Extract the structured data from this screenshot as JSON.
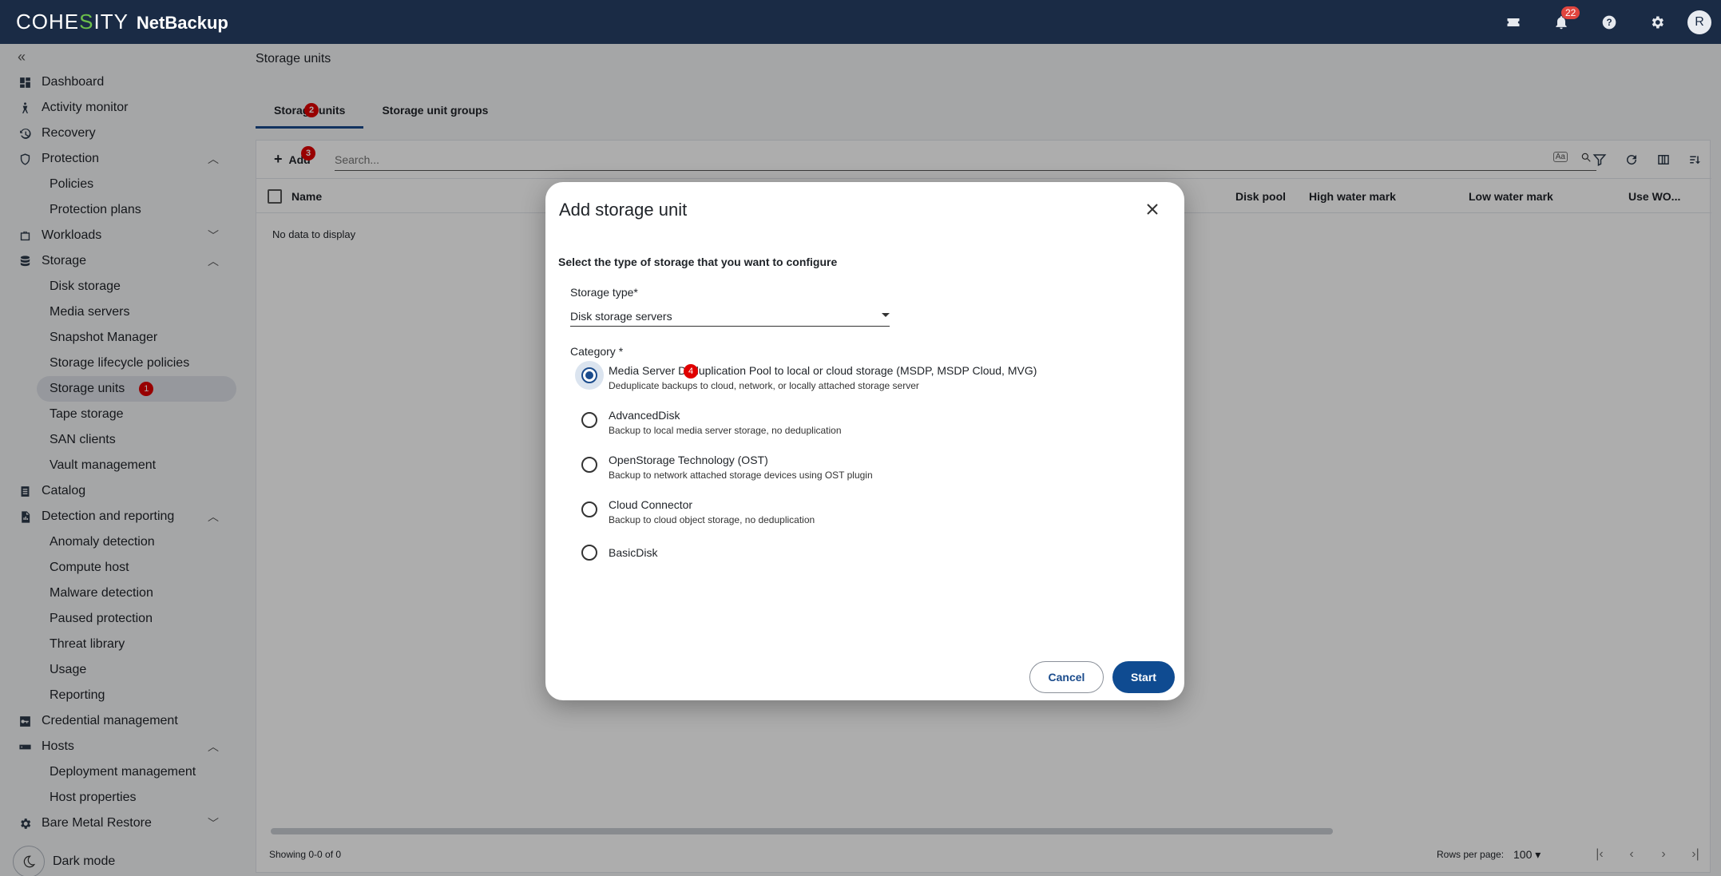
{
  "topbar": {
    "brand_left": "COHE",
    "brand_s": "S",
    "brand_right": "ITY",
    "product": "NetBackup",
    "notifications": "22",
    "avatar": "R"
  },
  "sidebar": {
    "dashboard": "Dashboard",
    "activity": "Activity monitor",
    "recovery": "Recovery",
    "protection": "Protection",
    "policies": "Policies",
    "protection_plans": "Protection plans",
    "workloads": "Workloads",
    "storage": "Storage",
    "disk_storage": "Disk storage",
    "media_servers": "Media servers",
    "snapshot_manager": "Snapshot Manager",
    "slp": "Storage lifecycle policies",
    "storage_units": "Storage units",
    "storage_units_badge": "1",
    "tape_storage": "Tape storage",
    "san_clients": "SAN clients",
    "vault": "Vault management",
    "catalog": "Catalog",
    "detection": "Detection and reporting",
    "anomaly": "Anomaly detection",
    "compute_host": "Compute host",
    "malware": "Malware detection",
    "paused": "Paused protection",
    "threat": "Threat library",
    "usage": "Usage",
    "reporting": "Reporting",
    "credential": "Credential management",
    "hosts": "Hosts",
    "deployment": "Deployment management",
    "host_props": "Host properties",
    "bmr": "Bare Metal Restore",
    "dark_mode": "Dark mode"
  },
  "main": {
    "page_title": "Storage units",
    "tab_units": "Storage units",
    "tab_units_badge": "2",
    "tab_groups": "Storage unit groups",
    "add_label": "Add",
    "add_badge": "3",
    "search_placeholder": "Search...",
    "aa": "Aa",
    "columns": {
      "name": "Name",
      "disk_pool": "Disk pool",
      "high": "High water mark",
      "low": "Low water mark",
      "use_wo": "Use WO..."
    },
    "empty": "No data to display",
    "showing": "Showing 0-0 of 0",
    "rows_per_page_label": "Rows per page:",
    "rows_per_page": "100"
  },
  "dialog": {
    "title": "Add storage unit",
    "subtitle": "Select the type of storage that you want to configure",
    "storage_type_label": "Storage type*",
    "storage_type_value": "Disk storage servers",
    "category_label": "Category *",
    "category_badge": "4",
    "options": [
      {
        "title": "Media Server Deduplication Pool to local or cloud storage (MSDP, MSDP Cloud, MVG)",
        "desc": "Deduplicate backups to cloud, network, or locally attached storage server"
      },
      {
        "title": "AdvancedDisk",
        "desc": "Backup to local media server storage, no deduplication"
      },
      {
        "title": "OpenStorage Technology (OST)",
        "desc": "Backup to network attached storage devices using OST plugin"
      },
      {
        "title": "Cloud Connector",
        "desc": "Backup to cloud object storage, no deduplication"
      },
      {
        "title": "BasicDisk",
        "desc": ""
      }
    ],
    "cancel": "Cancel",
    "start": "Start"
  }
}
